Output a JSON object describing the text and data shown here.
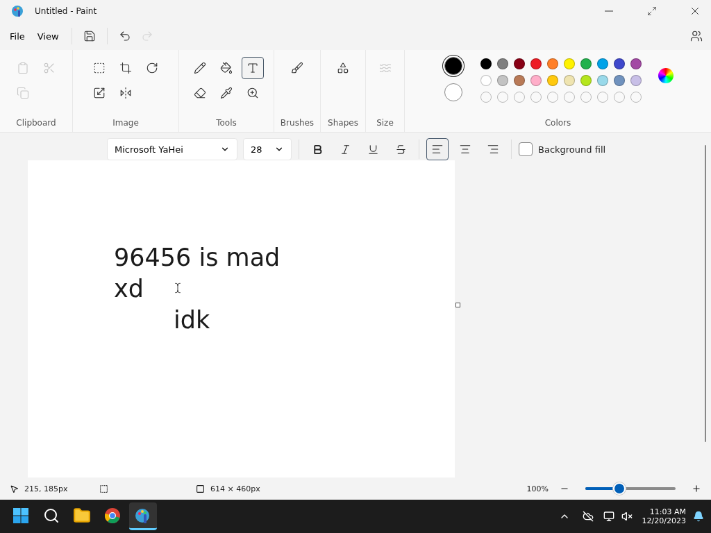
{
  "window": {
    "title": "Untitled - Paint"
  },
  "menu": [
    {
      "label": "File"
    },
    {
      "label": "View"
    }
  ],
  "quick_actions": [
    {
      "kind": "save",
      "disabled": false
    },
    {
      "kind": "undo",
      "disabled": false
    },
    {
      "kind": "redo",
      "disabled": true
    }
  ],
  "ribbon": [
    {
      "label": "Clipboard",
      "tools": [
        {
          "kind": "paste",
          "disabled": true
        },
        {
          "kind": "cut",
          "disabled": true
        },
        {
          "kind": "copy",
          "disabled": true
        }
      ]
    },
    {
      "label": "Image",
      "tools": [
        {
          "kind": "select",
          "disabled": false
        },
        {
          "kind": "crop",
          "disabled": false
        },
        {
          "kind": "rotate",
          "disabled": false
        },
        {
          "kind": "resize",
          "disabled": false
        },
        {
          "kind": "flip",
          "disabled": false
        }
      ]
    },
    {
      "label": "Tools",
      "tools": [
        {
          "kind": "pencil",
          "selected": false
        },
        {
          "kind": "fill",
          "selected": false
        },
        {
          "kind": "text",
          "selected": true
        },
        {
          "kind": "eraser",
          "selected": false
        },
        {
          "kind": "picker",
          "selected": false
        },
        {
          "kind": "magnifier",
          "selected": false
        }
      ]
    },
    {
      "label": "Brushes",
      "tools": [
        {
          "kind": "brush",
          "disabled": false
        }
      ]
    },
    {
      "label": "Shapes",
      "tools": [
        {
          "kind": "shapes",
          "disabled": false
        }
      ]
    },
    {
      "label": "Size",
      "tools": [
        {
          "kind": "size",
          "disabled": true
        }
      ]
    }
  ],
  "colors": {
    "label": "Colors",
    "current": [
      {
        "color": "#000000",
        "selected": true
      },
      {
        "color": "#ffffff",
        "selected": false
      }
    ],
    "palette": [
      {
        "color": "#000000"
      },
      {
        "color": "#7f7f7f"
      },
      {
        "color": "#880015"
      },
      {
        "color": "#ed1c24"
      },
      {
        "color": "#ff7f27"
      },
      {
        "color": "#fff200"
      },
      {
        "color": "#22b14c"
      },
      {
        "color": "#00a2e8"
      },
      {
        "color": "#3f48cc"
      },
      {
        "color": "#a349a4"
      },
      {
        "color": "#ffffff"
      },
      {
        "color": "#c3c3c3"
      },
      {
        "color": "#b97a57"
      },
      {
        "color": "#ffaec9"
      },
      {
        "color": "#ffc90e"
      },
      {
        "color": "#efe4b0"
      },
      {
        "color": "#b5e61d"
      },
      {
        "color": "#99d9ea"
      },
      {
        "color": "#7092be"
      },
      {
        "color": "#c8bfe7"
      }
    ]
  },
  "text_toolbar": {
    "font": "Microsoft YaHei",
    "size": "28",
    "styles": [
      {
        "kind": "bold",
        "selected": false
      },
      {
        "kind": "italic",
        "selected": false
      },
      {
        "kind": "underline",
        "selected": false
      },
      {
        "kind": "strikethrough",
        "selected": false
      }
    ],
    "alignment": [
      {
        "kind": "left",
        "selected": true
      },
      {
        "kind": "center",
        "selected": false
      },
      {
        "kind": "right",
        "selected": false
      }
    ],
    "background_fill": {
      "label": "Background fill",
      "checked": false
    }
  },
  "canvas": {
    "lines": [
      {
        "text": "96456 is mad",
        "kind": "plain"
      },
      {
        "text": "xd",
        "kind": "plain"
      },
      {
        "text": "idk",
        "kind": "indented"
      }
    ]
  },
  "status_bar": {
    "cursor": "215, 185px",
    "canvas_size": "614 × 460px",
    "zoom": "100%",
    "zoom_slider": {
      "level": 0.38
    }
  },
  "taskbar": {
    "apps": [
      {
        "kind": "start",
        "selected": false
      },
      {
        "kind": "search",
        "selected": false
      },
      {
        "kind": "explorer",
        "selected": false
      },
      {
        "kind": "browser",
        "selected": false
      },
      {
        "kind": "paint",
        "selected": true
      }
    ],
    "time": "11:03 AM",
    "date": "12/20/2023"
  }
}
